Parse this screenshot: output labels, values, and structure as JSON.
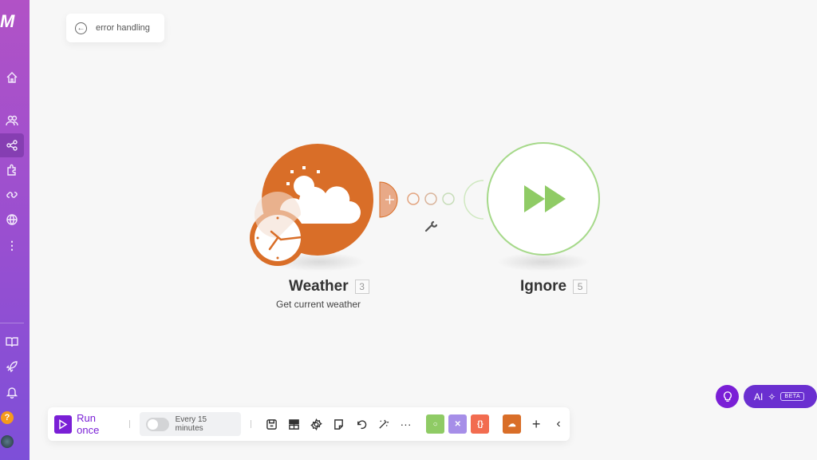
{
  "sidebar": {
    "logo": "M",
    "items": [
      "home",
      "team",
      "scenarios",
      "apps",
      "connections",
      "webhooks",
      "more",
      "docs",
      "whats-new",
      "notifications",
      "help",
      "profile"
    ],
    "help_label": "?"
  },
  "back": {
    "label": "error handling"
  },
  "nodes": [
    {
      "title": "Weather",
      "id": "3",
      "subtitle": "Get current weather",
      "color": "#d96e28"
    },
    {
      "title": "Ignore",
      "id": "5",
      "color": "#a6d98a"
    }
  ],
  "toolbar": {
    "run_label": "Run once",
    "schedule": "Every 15 minutes",
    "colors": {
      "run": "#7a1fd6",
      "tools": "#8fcb65",
      "flow": "#a68ee8",
      "text": "#f26c50",
      "weather": "#d96e28"
    }
  },
  "ai": {
    "label": "AI",
    "badge": "BETA"
  }
}
